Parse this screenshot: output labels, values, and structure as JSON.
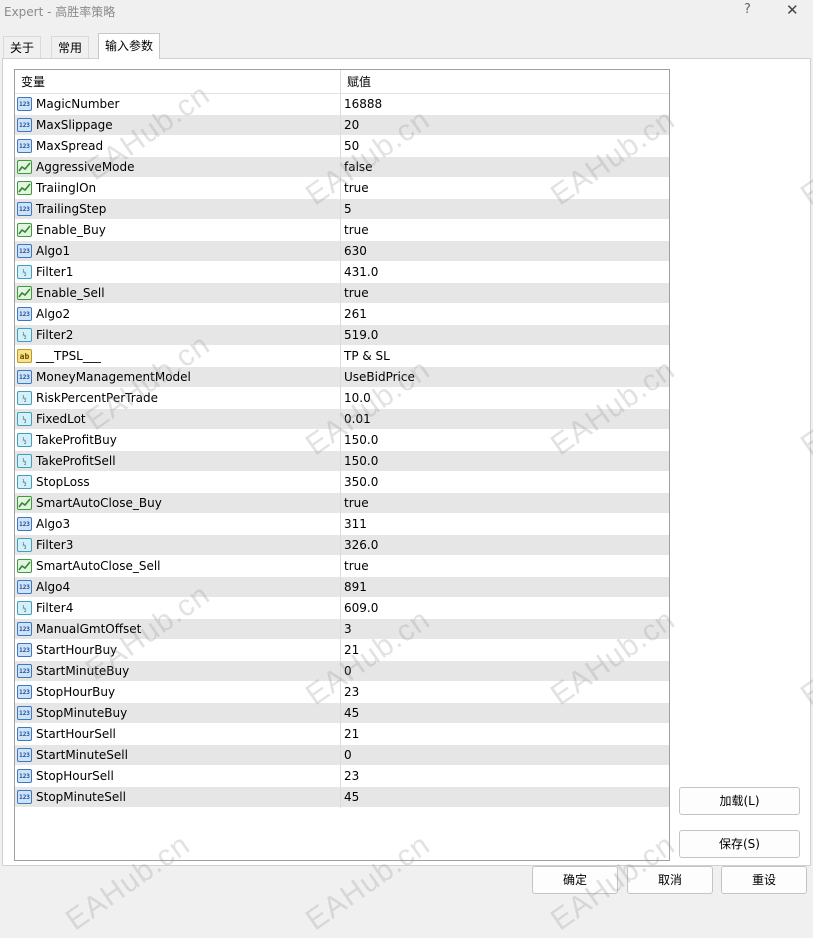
{
  "window": {
    "title": "Expert - 高胜率策略",
    "help_label": "?",
    "close_label": "✕"
  },
  "tabs": [
    {
      "label": "关于"
    },
    {
      "label": "常用"
    },
    {
      "label": "输入参数"
    }
  ],
  "active_tab": "输入参数",
  "table": {
    "headers": {
      "name": "变量",
      "value": "赋值"
    },
    "rows": [
      {
        "type": "int",
        "name": "MagicNumber",
        "value": "16888"
      },
      {
        "type": "int",
        "name": "MaxSlippage",
        "value": "20"
      },
      {
        "type": "int",
        "name": "MaxSpread",
        "value": "50"
      },
      {
        "type": "bool",
        "name": "AggressiveMode",
        "value": "false"
      },
      {
        "type": "bool",
        "name": "TraiinglOn",
        "value": "true"
      },
      {
        "type": "int",
        "name": "TrailingStep",
        "value": "5"
      },
      {
        "type": "bool",
        "name": "Enable_Buy",
        "value": "true"
      },
      {
        "type": "int",
        "name": "Algo1",
        "value": "630"
      },
      {
        "type": "dbl",
        "name": "Filter1",
        "value": "431.0"
      },
      {
        "type": "bool",
        "name": "Enable_Sell",
        "value": "true"
      },
      {
        "type": "int",
        "name": "Algo2",
        "value": "261"
      },
      {
        "type": "dbl",
        "name": "Filter2",
        "value": "519.0"
      },
      {
        "type": "str",
        "name": "___TPSL___",
        "value": "TP & SL"
      },
      {
        "type": "int",
        "name": "MoneyManagementModel",
        "value": "UseBidPrice"
      },
      {
        "type": "dbl",
        "name": "RiskPercentPerTrade",
        "value": "10.0"
      },
      {
        "type": "dbl",
        "name": "FixedLot",
        "value": "0.01"
      },
      {
        "type": "dbl",
        "name": "TakeProfitBuy",
        "value": "150.0"
      },
      {
        "type": "dbl",
        "name": "TakeProfitSell",
        "value": "150.0"
      },
      {
        "type": "dbl",
        "name": "StopLoss",
        "value": "350.0"
      },
      {
        "type": "bool",
        "name": "SmartAutoClose_Buy",
        "value": "true"
      },
      {
        "type": "int",
        "name": "Algo3",
        "value": "311"
      },
      {
        "type": "dbl",
        "name": "Filter3",
        "value": "326.0"
      },
      {
        "type": "bool",
        "name": "SmartAutoClose_Sell",
        "value": "true"
      },
      {
        "type": "int",
        "name": "Algo4",
        "value": "891"
      },
      {
        "type": "dbl",
        "name": "Filter4",
        "value": "609.0"
      },
      {
        "type": "int",
        "name": "ManualGmtOffset",
        "value": "3"
      },
      {
        "type": "int",
        "name": "StartHourBuy",
        "value": "21"
      },
      {
        "type": "int",
        "name": "StartMinuteBuy",
        "value": "0"
      },
      {
        "type": "int",
        "name": "StopHourBuy",
        "value": "23"
      },
      {
        "type": "int",
        "name": "StopMinuteBuy",
        "value": "45"
      },
      {
        "type": "int",
        "name": "StartHourSell",
        "value": "21"
      },
      {
        "type": "int",
        "name": "StartMinuteSell",
        "value": "0"
      },
      {
        "type": "int",
        "name": "StopHourSell",
        "value": "23"
      },
      {
        "type": "int",
        "name": "StopMinuteSell",
        "value": "45"
      }
    ]
  },
  "icon_glyphs": {
    "int": "123",
    "dbl": "½",
    "str": "ab"
  },
  "side_buttons": {
    "load": "加载(L)",
    "save": "保存(S)"
  },
  "footer_buttons": {
    "ok": "确定",
    "cancel": "取消",
    "reset": "重设"
  },
  "watermark_text": "EAHub.cn"
}
